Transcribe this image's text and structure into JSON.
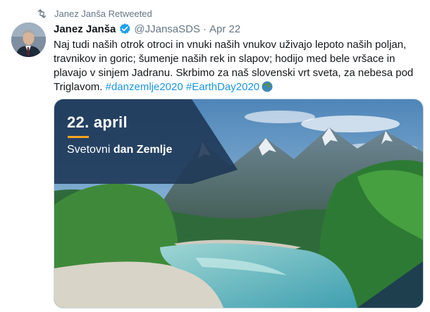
{
  "retweet": {
    "label": "Janez Janša Retweeted"
  },
  "author": {
    "name": "Janez Janša",
    "handle": "@JJansaSDS",
    "separator": "·",
    "date": "Apr 22"
  },
  "tweet": {
    "text": "Naj tudi naših otrok otroci in vnuki naših vnukov uživajo lepoto naših poljan, travnikov in goric; šumenje naših rek in slapov; hodijo med bele vršace in plavajo v sinjem Jadranu. Skrbimo za naš slovenski vrt sveta, za nebesa pod Triglavom. ",
    "hashtags": [
      "#danzemlje2020",
      "#EarthDay2020"
    ],
    "emoji": "earth-globe-icon"
  },
  "image": {
    "date": "22. april",
    "caption_prefix": "Svetovni ",
    "caption_bold": "dan Zemlje"
  },
  "colors": {
    "link": "#1b95e0",
    "muted": "#657786",
    "verified": "#1da1f2",
    "accent": "#f5a623"
  }
}
